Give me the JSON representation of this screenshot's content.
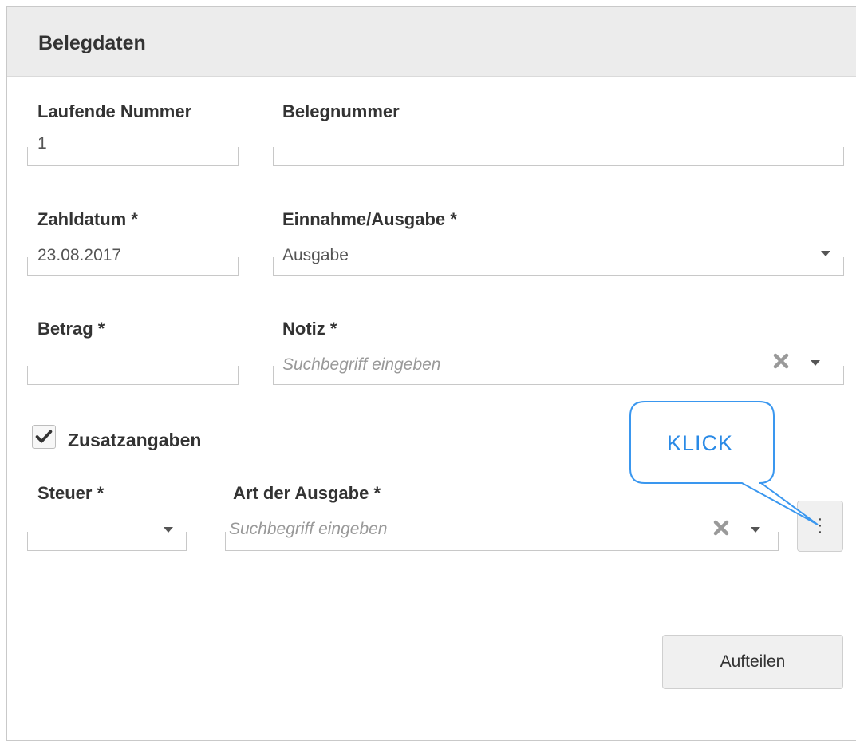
{
  "panel": {
    "title": "Belegdaten"
  },
  "form": {
    "laufende_nummer": {
      "label": "Laufende Nummer",
      "value": "1"
    },
    "belegnummer": {
      "label": "Belegnummer",
      "value": ""
    },
    "zahldatum": {
      "label": "Zahldatum *",
      "value": "23.08.2017"
    },
    "einnahme_ausgabe": {
      "label": "Einnahme/Ausgabe *",
      "value": "Ausgabe"
    },
    "betrag": {
      "label": "Betrag *",
      "value": ""
    },
    "notiz": {
      "label": "Notiz *",
      "placeholder": "Suchbegriff eingeben"
    },
    "zusatzangaben": {
      "label": "Zusatzangaben",
      "checked": true
    },
    "steuer": {
      "label": "Steuer *",
      "value": ""
    },
    "art_der_ausgabe": {
      "label": "Art der Ausgabe *",
      "placeholder": "Suchbegriff eingeben"
    }
  },
  "callout": {
    "text": "KLICK"
  },
  "buttons": {
    "aufteilen": "Aufteilen"
  },
  "colors": {
    "header_bg": "#ececec",
    "callout_blue": "#2a8ae6",
    "border": "#c8c8c8"
  },
  "icons": [
    "checkmark-icon",
    "clear-x-icon",
    "caret-down-icon",
    "vertical-dots-icon"
  ]
}
